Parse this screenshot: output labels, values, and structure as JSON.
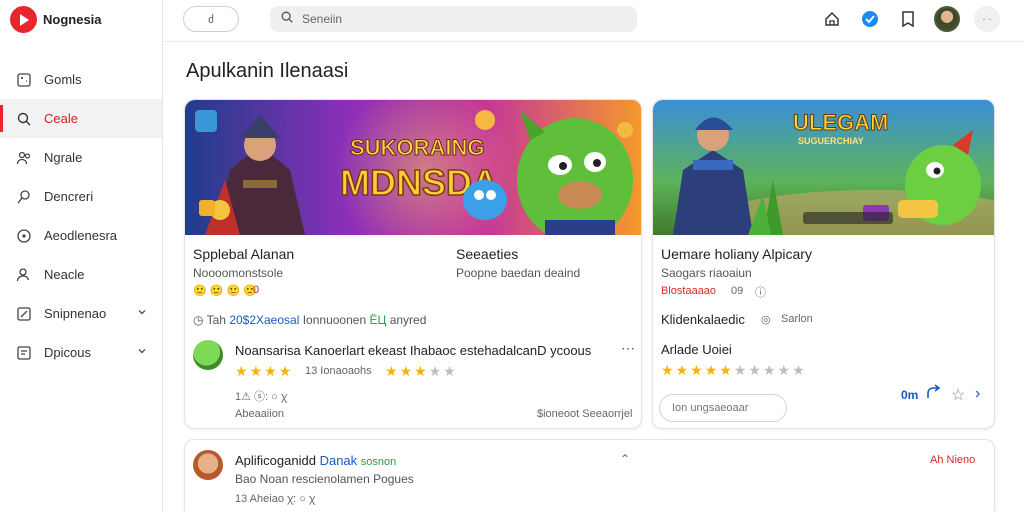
{
  "brand": {
    "name": "Nognesia",
    "logo_color": "#e8262c"
  },
  "sidebar": {
    "items": [
      {
        "label": "Gomls",
        "icon": "controller-icon"
      },
      {
        "label": "Ceale",
        "icon": "search-icon",
        "active": true
      },
      {
        "label": "Ngrale",
        "icon": "people-icon"
      },
      {
        "label": "Dencreri",
        "icon": "pencil-icon"
      },
      {
        "label": "Aeodlenesra",
        "icon": "compass-icon"
      },
      {
        "label": "Neacle",
        "icon": "user-icon"
      },
      {
        "label": "Snipnenao",
        "icon": "edit-box-icon",
        "expandable": true
      },
      {
        "label": "Dpicous",
        "icon": "document-icon",
        "expandable": true
      }
    ]
  },
  "topbar": {
    "pill_label": "ძ",
    "search_placeholder": "Seneiin"
  },
  "page": {
    "title": "Apulkanin Ilenaasi"
  },
  "card1": {
    "banner_text_top": "SUKORAING",
    "banner_text_main": "MDNSDA",
    "left_title": "Spplebal Alanan",
    "left_sub": "Noooomonstsole",
    "left_badges": "🙂 🙂 🙂 🙂",
    "left_badge_count": "0",
    "right_title": "Seeaeties",
    "right_sub": "Poopne baedan deaind",
    "info_prefix": "Tah",
    "info_link": "20$2Xaeosal",
    "info_mid": "Ionnuoonen",
    "info_green": "ЁЦ",
    "info_end": "anyred",
    "review_text": "Noansarisa Kanoerlart ekeast Ihabaoc estehadalcanD ycoous",
    "review_count_text": "13 Ionaoaohs",
    "review_rating": 3.5,
    "review_rating2": 3,
    "foot_left_icons": "1⚠ ⓢ: ○ ꭓ",
    "foot_left_text": "Abeaaiion",
    "foot_right": "$ioneoot Seeaorrjel"
  },
  "card2": {
    "banner_text_top": "ULEGAM",
    "banner_text_sub": "SUGUERCHIAY",
    "title": "Uemare holiany Alpicary",
    "sub": "Saogars riaoaiun",
    "meta": "Blostaaaao",
    "meta_count": "09",
    "line2": "Klidenkalaedic",
    "line2_tag": "Sarlon",
    "rating_label": "Arlade Uoiei",
    "rating_value": 4.5,
    "input_placeholder": "Ion ungsaeoaar",
    "action_label": "0m"
  },
  "card3": {
    "name": "Aplificoganidd",
    "name_link": "Danak",
    "name_green": "sosnon",
    "sub": "Bao Noan rescienolamen Pogues",
    "meta": "13 Aheiao ꭓ: ○ ꭓ",
    "right_tag": "Ah Nieno"
  }
}
